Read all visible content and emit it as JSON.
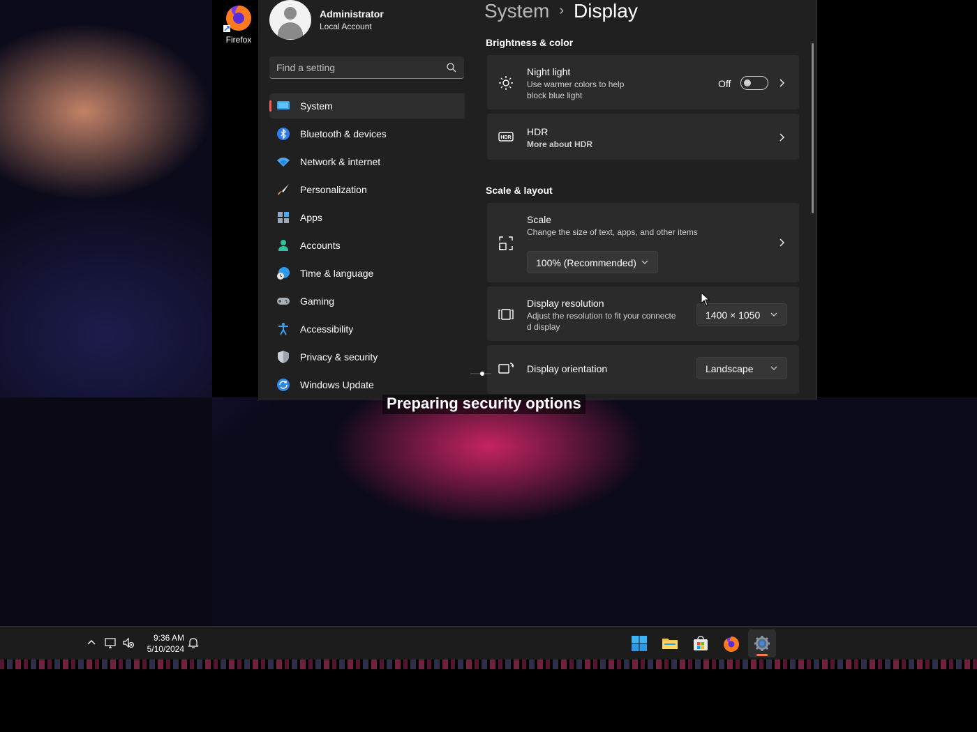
{
  "desktop": {
    "icons": [
      {
        "label": "Firefox",
        "icon": "firefox-icon"
      }
    ]
  },
  "settings": {
    "user": {
      "name": "Administrator",
      "account_type": "Local Account"
    },
    "search": {
      "placeholder": "Find a setting",
      "value": ""
    },
    "nav": [
      {
        "label": "System",
        "icon": "system-icon",
        "active": true
      },
      {
        "label": "Bluetooth & devices",
        "icon": "bluetooth-icon"
      },
      {
        "label": "Network & internet",
        "icon": "wifi-icon"
      },
      {
        "label": "Personalization",
        "icon": "brush-icon"
      },
      {
        "label": "Apps",
        "icon": "apps-icon"
      },
      {
        "label": "Accounts",
        "icon": "accounts-icon"
      },
      {
        "label": "Time & language",
        "icon": "globe-clock-icon"
      },
      {
        "label": "Gaming",
        "icon": "gamepad-icon"
      },
      {
        "label": "Accessibility",
        "icon": "accessibility-icon"
      },
      {
        "label": "Privacy & security",
        "icon": "shield-icon"
      },
      {
        "label": "Windows Update",
        "icon": "update-icon"
      }
    ],
    "breadcrumb": {
      "parent": "System",
      "separator": "›",
      "current": "Display"
    },
    "sections": {
      "brightness": {
        "title": "Brightness & color",
        "night_light": {
          "title": "Night light",
          "desc": "Use warmer colors to help block blue light",
          "state": "Off",
          "on": false
        },
        "hdr": {
          "title": "HDR",
          "link": "More about HDR"
        }
      },
      "scale_layout": {
        "title": "Scale & layout",
        "scale": {
          "title": "Scale",
          "desc": "Change the size of text, apps, and other items",
          "value": "100% (Recommended)"
        },
        "resolution": {
          "title": "Display resolution",
          "desc": "Adjust the resolution to fit your connected display",
          "desc_line1": "Adjust the resolution to fit your connecte",
          "desc_line2": "d display",
          "value": "1400 × 1050"
        },
        "orientation": {
          "title": "Display orientation",
          "value": "Landscape"
        }
      }
    }
  },
  "overlay": {
    "text": "Preparing security options"
  },
  "taskbar": {
    "time": "9:36 AM",
    "date": "5/10/2024",
    "tray_icons": [
      "chevron-up-icon",
      "display-network-icon",
      "speaker-muted-icon",
      "notification-icon"
    ],
    "apps": [
      {
        "name": "Start",
        "icon": "windows-start-icon"
      },
      {
        "name": "File Explorer",
        "icon": "folder-icon"
      },
      {
        "name": "Microsoft Store",
        "icon": "store-icon"
      },
      {
        "name": "Firefox",
        "icon": "firefox-icon"
      },
      {
        "name": "Settings",
        "icon": "gear-icon",
        "active": true
      }
    ]
  },
  "colors": {
    "accent": "#ff5c5c",
    "link": "#f0a875",
    "window_bg": "#202020",
    "card_bg": "#2b2b2b"
  }
}
